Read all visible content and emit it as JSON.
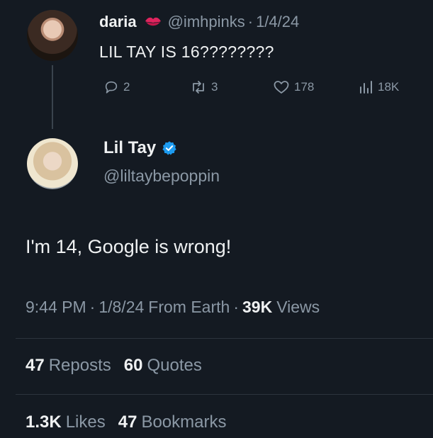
{
  "reply_to": {
    "display_name": "daria",
    "handle": "@imhpinks",
    "separator": "·",
    "date": "1/4/24",
    "text": "LIL TAY IS 16????????",
    "metrics": {
      "replies": "2",
      "reposts": "3",
      "likes": "178",
      "views": "18K"
    },
    "name_emoji_icon": "kiss-mark-icon"
  },
  "post": {
    "display_name": "Lil Tay",
    "handle": "@liltaybepoppin",
    "verified_icon": "verified-badge-icon",
    "text": "I'm 14, Google is wrong!",
    "time": "9:44 PM",
    "separator1": "·",
    "date": "1/8/24",
    "source": "From Earth",
    "separator2": "·",
    "views_count": "39K",
    "views_label": "Views",
    "reposts_count": "47",
    "reposts_label": "Reposts",
    "quotes_count": "60",
    "quotes_label": "Quotes",
    "likes_count": "1.3K",
    "likes_label": "Likes",
    "bookmarks_count": "47",
    "bookmarks_label": "Bookmarks"
  },
  "colors": {
    "background": "#141a22",
    "text": "#e7e9ea",
    "muted": "#8b98a5",
    "verified": "#1d9bf0",
    "emoji": "#e0245e"
  }
}
